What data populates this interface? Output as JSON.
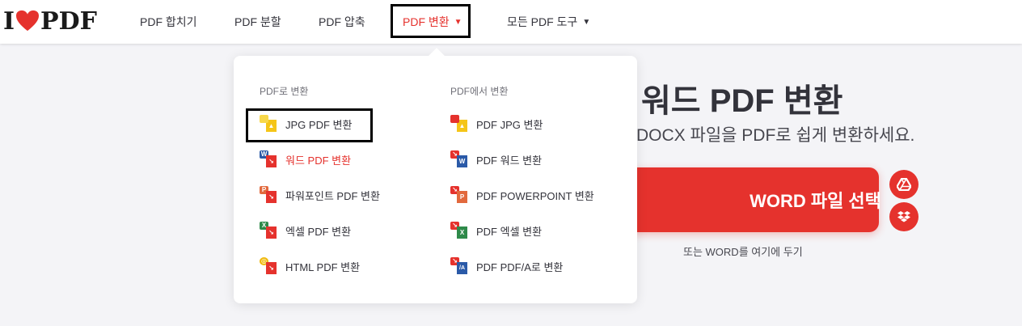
{
  "logo": {
    "left": "I",
    "right": "PDF"
  },
  "nav": {
    "merge": "PDF 합치기",
    "split": "PDF 분할",
    "compress": "PDF 압축",
    "convert": "PDF 변환",
    "all_tools": "모든 PDF 도구"
  },
  "dropdown": {
    "to_pdf": {
      "heading": "PDF로 변환",
      "items": [
        "JPG PDF 변환",
        "워드 PDF 변환",
        "파워포인트 PDF 변환",
        "엑셀 PDF 변환",
        "HTML PDF 변환"
      ]
    },
    "from_pdf": {
      "heading": "PDF에서 변환",
      "items": [
        "PDF JPG 변환",
        "PDF 워드 변환",
        "PDF POWERPOINT 변환",
        "PDF 엑셀 변환",
        "PDF PDF/A로 변환"
      ]
    }
  },
  "hero": {
    "title": "워드 PDF 변환",
    "subtitle": "DOCX 파일을 PDF로 쉽게 변환하세요.",
    "select_button": "WORD 파일 선택",
    "drop_hint": "또는 WORD를 여기에 두기"
  },
  "colors": {
    "brand": "#e5322d",
    "jpg": "#f5c518",
    "word": "#2b5aa8",
    "powerpoint": "#e2693d",
    "excel": "#2f8a4a",
    "html": "#f0b90b"
  },
  "icons": [
    "google-drive-icon",
    "dropbox-icon",
    "caret-down-icon",
    "heart-icon"
  ]
}
